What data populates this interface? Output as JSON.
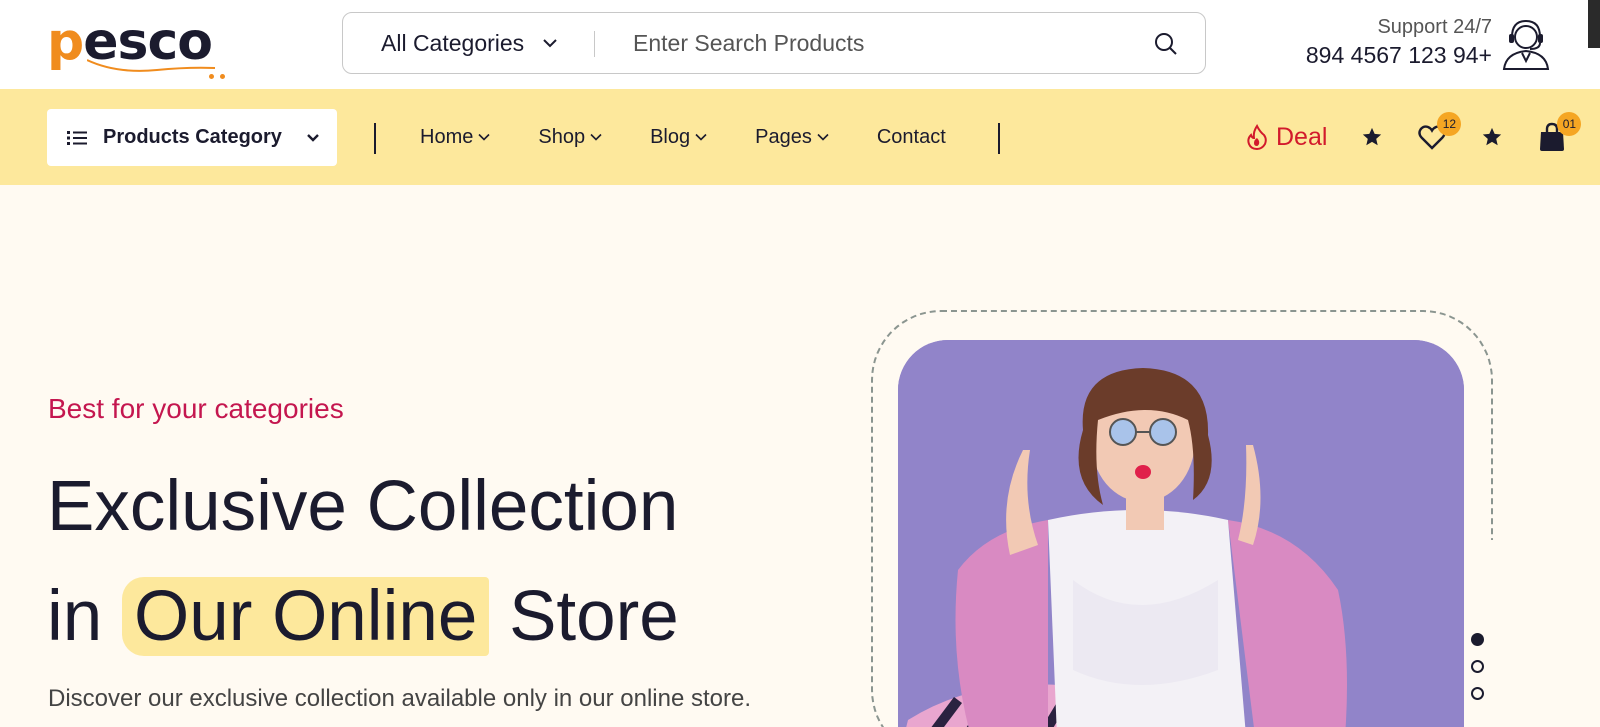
{
  "brand": {
    "name_p": "p",
    "name_rest": "esco"
  },
  "search": {
    "category": "All Categories",
    "placeholder": "Enter Search Products"
  },
  "support": {
    "label": "Support 24/7",
    "phone": "894 4567 123 94+"
  },
  "nav": {
    "products_category": "Products Category",
    "items": [
      {
        "label": "Home",
        "has_dropdown": true
      },
      {
        "label": "Shop",
        "has_dropdown": true
      },
      {
        "label": "Blog",
        "has_dropdown": true
      },
      {
        "label": "Pages",
        "has_dropdown": true
      },
      {
        "label": "Contact",
        "has_dropdown": false
      }
    ],
    "deal": "Deal",
    "wishlist_count": "12",
    "cart_count": "01"
  },
  "hero": {
    "subtitle": "Best for your categories",
    "title_line1": "Exclusive Collection",
    "title_line2_pre": "in",
    "title_highlight": "Our Online",
    "title_line2_post": "Store",
    "description": "Discover our exclusive collection available only in our online store.",
    "slides_total": 3,
    "slide_active": 1
  },
  "colors": {
    "brand_orange": "#f08c1e",
    "nav_yellow": "#fde89c",
    "accent_red": "#d21a2c",
    "subtitle_pink": "#c4164f",
    "badge_orange": "#f5a623",
    "hero_bg": "#fffaf2",
    "photo_bg": "#9184c9"
  },
  "icons": {
    "search": "search-icon",
    "support": "support-agent-icon",
    "menu": "list-icon",
    "deal": "flame-icon",
    "wishlist": "heart-icon",
    "star": "star-icon",
    "cart": "shopping-bag-icon"
  }
}
